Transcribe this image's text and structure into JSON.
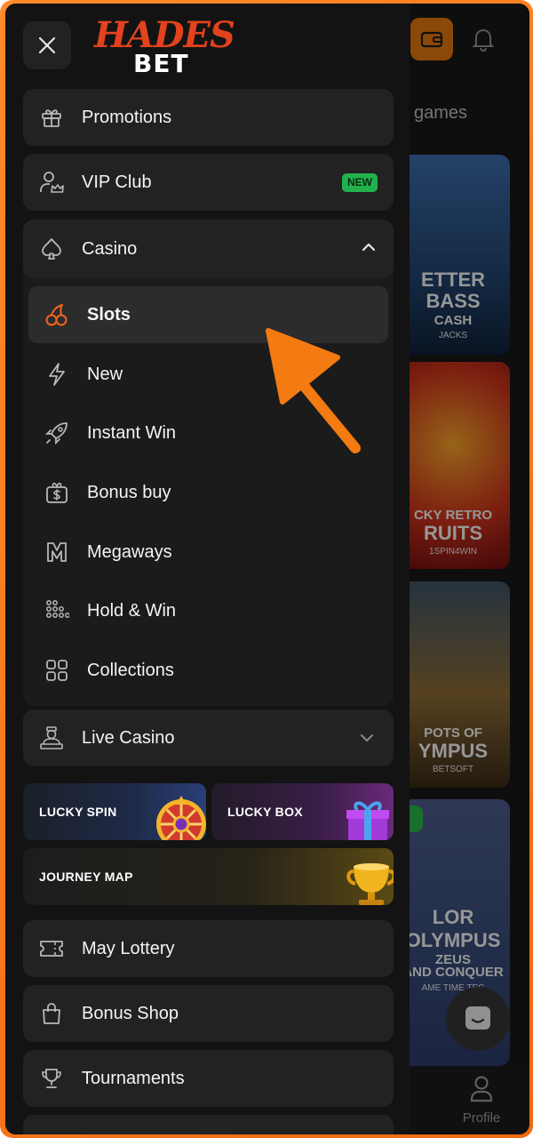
{
  "brand": {
    "name_top": "HADES",
    "name_bottom": "BET"
  },
  "drawer": {
    "menu": [
      {
        "label": "Promotions",
        "icon": "gift-icon"
      },
      {
        "label": "VIP Club",
        "icon": "vip-user-icon",
        "badge": "NEW"
      }
    ],
    "casino": {
      "label": "Casino",
      "icon": "spade-icon",
      "expanded": true,
      "items": [
        {
          "label": "Slots",
          "icon": "cherries-icon",
          "active": true
        },
        {
          "label": "New",
          "icon": "lightning-icon"
        },
        {
          "label": "Instant Win",
          "icon": "rocket-icon"
        },
        {
          "label": "Bonus buy",
          "icon": "dollar-gift-icon"
        },
        {
          "label": "Megaways",
          "icon": "megaways-icon"
        },
        {
          "label": "Hold & Win",
          "icon": "dots-grid-icon"
        },
        {
          "label": "Collections",
          "icon": "grid-icon"
        }
      ]
    },
    "live_casino": {
      "label": "Live Casino",
      "icon": "dealer-icon"
    },
    "promo_tiles": {
      "lucky_spin": "LUCKY SPIN",
      "lucky_box": "LUCKY BOX",
      "journey_map": "JOURNEY MAP"
    },
    "bottom_menu": [
      {
        "label": "May Lottery",
        "icon": "ticket-icon"
      },
      {
        "label": "Bonus Shop",
        "icon": "shopping-bag-icon"
      },
      {
        "label": "Tournaments",
        "icon": "trophy-icon"
      }
    ]
  },
  "background_page": {
    "heading": "w games",
    "cards": [
      {
        "line1": "ETTER",
        "line2": "BASS",
        "line3": "CASH",
        "provider": "JACKS"
      },
      {
        "line1": "CKY RETRO",
        "line2": "RUITS",
        "provider": "1SPIN4WIN"
      },
      {
        "line1": "POTS OF",
        "line2": "YMPUS",
        "provider": "BETSOFT"
      },
      {
        "line1": "LOR",
        "line2": "OLYMPUS",
        "line3": "ZEUS",
        "line4": "AND CONQUER",
        "provider": "AME TIME TEC"
      }
    ],
    "tabbar": {
      "profile_label": "Profile"
    }
  },
  "colors": {
    "accent": "#f07a1a",
    "frame": "#f06a10",
    "drawer_bg": "#131313",
    "item_bg": "#222222",
    "badge_green": "#23b14d"
  }
}
